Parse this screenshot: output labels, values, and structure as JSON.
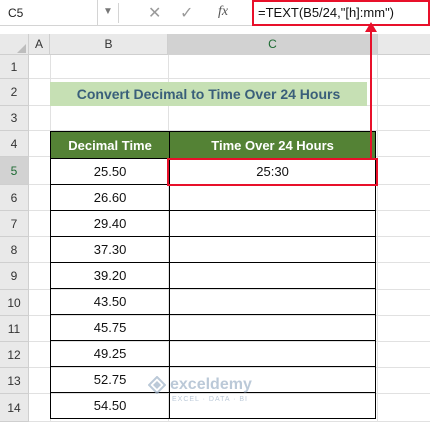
{
  "formula_bar": {
    "name_box": "C5",
    "cancel_icon": "✕",
    "enter_icon": "✓",
    "fx_label": "fx",
    "formula": "=TEXT(B5/24,\"[h]:mm\")"
  },
  "columns": [
    "A",
    "B",
    "C"
  ],
  "rows": [
    "1",
    "2",
    "3",
    "4",
    "5",
    "6",
    "7",
    "8",
    "9",
    "10",
    "11",
    "12",
    "13",
    "14"
  ],
  "title": "Convert Decimal to Time Over 24 Hours",
  "table": {
    "headers": [
      "Decimal Time",
      "Time Over 24 Hours"
    ],
    "rows": [
      {
        "decimal": "25.50",
        "time": "25:30"
      },
      {
        "decimal": "26.60",
        "time": ""
      },
      {
        "decimal": "29.40",
        "time": ""
      },
      {
        "decimal": "37.30",
        "time": ""
      },
      {
        "decimal": "39.20",
        "time": ""
      },
      {
        "decimal": "43.50",
        "time": ""
      },
      {
        "decimal": "45.75",
        "time": ""
      },
      {
        "decimal": "49.25",
        "time": ""
      },
      {
        "decimal": "52.75",
        "time": ""
      },
      {
        "decimal": "54.50",
        "time": ""
      }
    ]
  },
  "watermark": {
    "name": "exceldemy",
    "tagline": "EXCEL · DATA · BI"
  },
  "colors": {
    "header_green": "#548235",
    "title_fill": "#c6e0b4",
    "highlight_red": "#e8102a"
  }
}
